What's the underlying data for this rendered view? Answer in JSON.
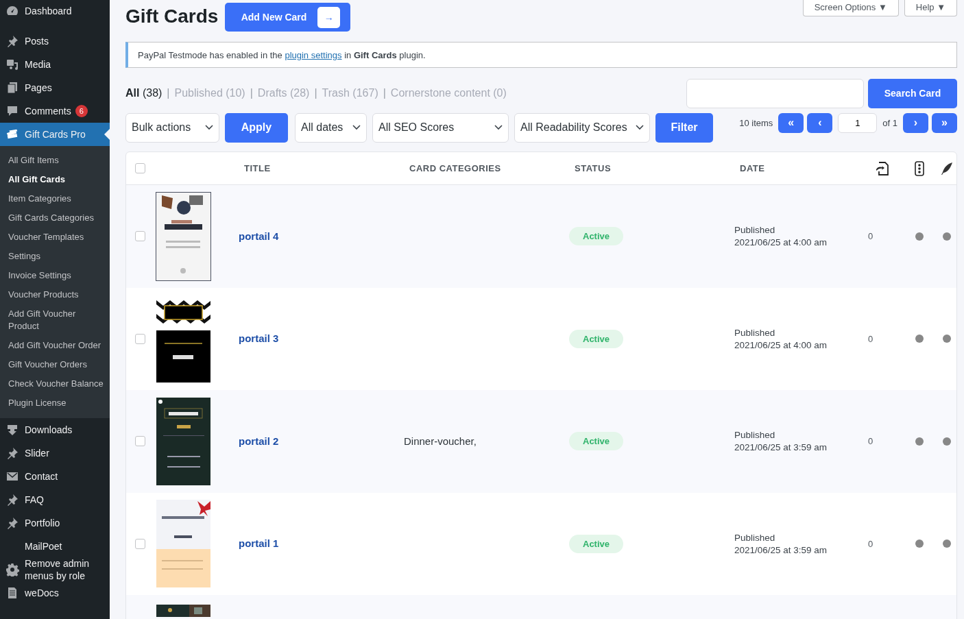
{
  "sidebar": {
    "items": [
      {
        "label": "Dashboard",
        "selected": false
      },
      {
        "label": "Posts",
        "selected": false
      },
      {
        "label": "Media",
        "selected": false
      },
      {
        "label": "Pages",
        "selected": false
      },
      {
        "label": "Comments",
        "selected": false,
        "badge": "6"
      },
      {
        "label": "Gift Cards Pro",
        "selected": true,
        "children": [
          {
            "label": "All Gift Items",
            "selected": false
          },
          {
            "label": "All Gift Cards",
            "selected": true
          },
          {
            "label": "Item Categories",
            "selected": false
          },
          {
            "label": "Gift Cards Categories",
            "selected": false
          },
          {
            "label": "Voucher Templates",
            "selected": false
          },
          {
            "label": "Settings",
            "selected": false
          },
          {
            "label": "Invoice Settings",
            "selected": false
          },
          {
            "label": "Voucher Products",
            "selected": false
          },
          {
            "label": "Add Gift Voucher Product",
            "selected": false
          },
          {
            "label": "Add Gift Voucher Order",
            "selected": false
          },
          {
            "label": "Gift Voucher Orders",
            "selected": false
          },
          {
            "label": "Check Voucher Balance",
            "selected": false
          },
          {
            "label": "Plugin License",
            "selected": false
          }
        ]
      },
      {
        "label": "Downloads",
        "selected": false
      },
      {
        "label": "Slider",
        "selected": false
      },
      {
        "label": "Contact",
        "selected": false
      },
      {
        "label": "FAQ",
        "selected": false
      },
      {
        "label": "Portfolio",
        "selected": false
      },
      {
        "label": "MailPoet",
        "selected": false
      },
      {
        "label": "Remove admin menus by role",
        "selected": false
      },
      {
        "label": "weDocs",
        "selected": false
      }
    ]
  },
  "screen_options": [
    "Screen Options",
    "Help"
  ],
  "screen_options_caret": "▼",
  "page_title": "Gift Cards",
  "add_button": {
    "label": "Add New Card",
    "arrow": "→"
  },
  "notice": {
    "before": "PayPal Testmode has enabled in the",
    "link": "plugin settings",
    "after": "in **Gift Cards** plugin."
  },
  "views": [
    {
      "label": "All",
      "count": "(38)",
      "selected": true,
      "separator": "|"
    },
    {
      "label": "Published",
      "count": "(10)",
      "selected": false,
      "separator": "|"
    },
    {
      "label": "Drafts",
      "count": "(28)",
      "selected": false,
      "separator": "|"
    },
    {
      "label": "Trash",
      "count": "(167)",
      "selected": false,
      "separator": "|"
    },
    {
      "label": "Cornerstone content",
      "count": "(0)",
      "selected": false
    }
  ],
  "search": {
    "button": "Search Card"
  },
  "filters": {
    "bulk": "Bulk actions",
    "apply": "Apply",
    "dates": "All dates",
    "seo": "All SEO Scores",
    "readability": "All Readability Scores",
    "filter": "Filter"
  },
  "pagination": {
    "items": "10 items",
    "first": "«",
    "prev": "‹",
    "page": "1",
    "of": "of 1",
    "next": "›",
    "last": "»"
  },
  "table": {
    "select_all_checked": false,
    "columns": [
      "TITLE",
      "CARD CATEGORIES",
      "STATUS",
      "DATE"
    ],
    "rows": [
      {
        "thumbnail": {
          "kind": "picture"
        },
        "checked": false,
        "title": "portail 4",
        "status": "Active",
        "date_status": "Published",
        "date_time": "2021/06/25 at 4:00 am",
        "links": "0"
      },
      {
        "thumbnail": {
          "kind": "picture"
        },
        "checked": false,
        "title": "portail 3",
        "status": "Active",
        "date_status": "Published",
        "date_time": "2021/06/25 at 4:00 am",
        "links": "0"
      },
      {
        "thumbnail": {
          "kind": "picture"
        },
        "checked": false,
        "title": "portail 2",
        "category": "Dinner-voucher,",
        "status": "Active",
        "date_status": "Published",
        "date_time": "2021/06/25 at 3:59 am",
        "links": "0"
      },
      {
        "thumbnail": {
          "kind": "picture"
        },
        "checked": false,
        "title": "portail 1",
        "status": "Active",
        "date_status": "Published",
        "date_time": "2021/06/25 at 3:59 am",
        "links": "0"
      },
      {
        "thumbnail": {
          "kind": "picture"
        }
      }
    ]
  }
}
